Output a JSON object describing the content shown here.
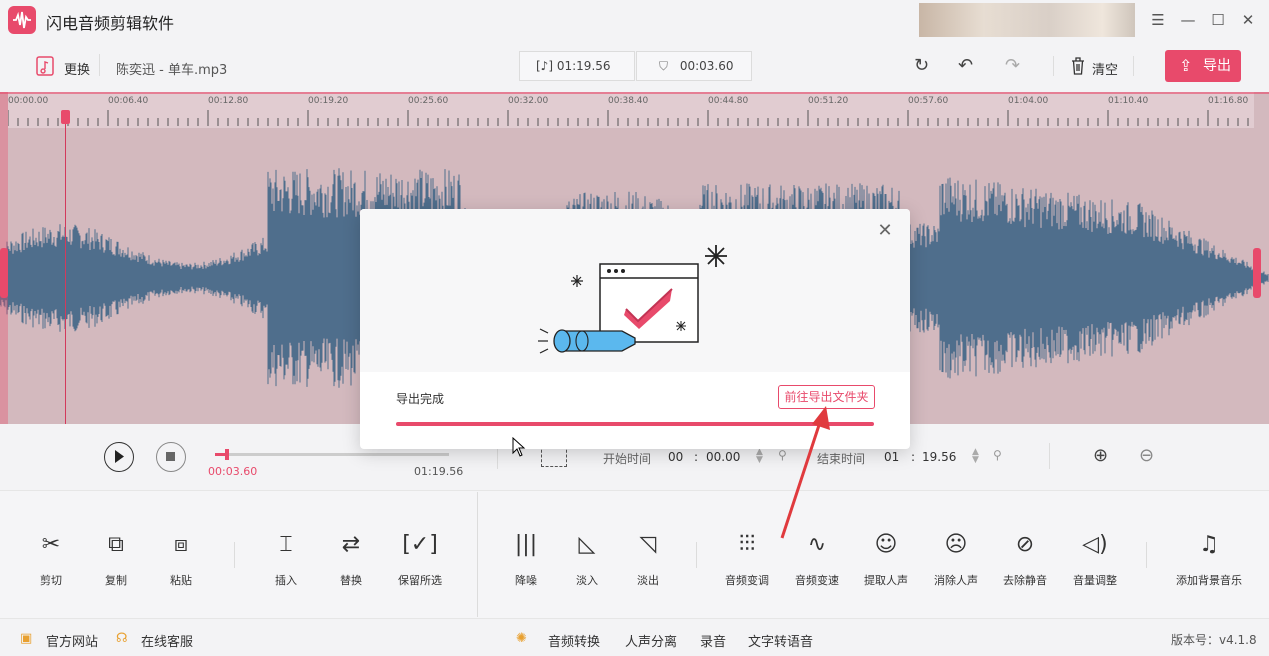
{
  "app": {
    "title": "闪电音频剪辑软件"
  },
  "toolbar": {
    "replace_label": "更换",
    "file_name": "陈奕迅 - 单车.mp3",
    "total_time": "01:19.56",
    "selection_time": "00:03.60",
    "clear_label": "清空",
    "export_label": "导出"
  },
  "ruler": {
    "labels": [
      "00:00.00",
      "00:06.40",
      "00:12.80",
      "00:19.20",
      "00:25.60",
      "00:32.00",
      "00:38.40",
      "00:44.80",
      "00:51.20",
      "00:57.60",
      "01:04.00",
      "01:10.40",
      "01:16.80"
    ]
  },
  "player": {
    "current_time": "00:03.60",
    "total_time": "01:19.56",
    "progress_fraction": 0.045,
    "start_label": "开始时间",
    "start_min": "00",
    "start_sec": "00.00",
    "end_label": "结束时间",
    "end_min": "01",
    "end_sec": "19.56"
  },
  "tools": {
    "cut": "剪切",
    "copy": "复制",
    "paste": "粘贴",
    "insert": "插入",
    "replace": "替换",
    "keep": "保留所选",
    "denoise": "降噪",
    "fade_in": "淡入",
    "fade_out": "淡出",
    "pitch": "音频变调",
    "speed": "音频变速",
    "extract_voice": "提取人声",
    "remove_voice": "消除人声",
    "remove_silence": "去除静音",
    "volume": "音量调整",
    "bgm": "添加背景音乐"
  },
  "status": {
    "website": "官方网站",
    "support": "在线客服",
    "convert": "音频转换",
    "separate": "人声分离",
    "record": "录音",
    "tts": "文字转语音",
    "version": "版本号：v4.1.8"
  },
  "modal": {
    "done": "导出完成",
    "open_folder": "前往导出文件夹",
    "progress_fraction": 1.0
  },
  "colors": {
    "accent": "#e84a6b",
    "wave": "#4f6e8c",
    "wave_bg": "#d3b9be",
    "arrow": "#e03a3e"
  }
}
